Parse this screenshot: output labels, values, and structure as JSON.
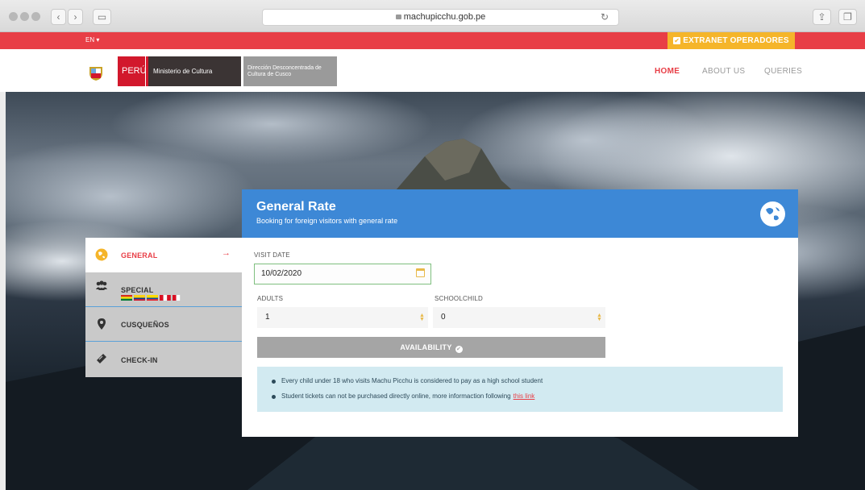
{
  "browser": {
    "url": "machupicchu.gob.pe",
    "icons": [
      "back-icon",
      "forward-icon",
      "sidebar-icon",
      "lock-icon",
      "reload-icon",
      "share-icon",
      "tabs-icon"
    ]
  },
  "topbar": {
    "language": "EN ▾",
    "extranet_label": "EXTRANET OPERADORES"
  },
  "header": {
    "logo_peru": "PERÚ",
    "logo_ministry": "Ministerio de Cultura",
    "logo_ddc": "Dirección Desconcentrada de Cultura de Cusco",
    "nav": [
      {
        "label": "HOME",
        "active": true
      },
      {
        "label": "ABOUT US",
        "active": false
      },
      {
        "label": "QUERIES",
        "active": false
      }
    ]
  },
  "sidebar": {
    "tabs": [
      {
        "label": "GENERAL",
        "icon": "globe-icon",
        "active": true
      },
      {
        "label": "SPECIAL",
        "icon": "group-icon",
        "active": false
      },
      {
        "label": "CUSQUEÑOS",
        "icon": "map-pin-icon",
        "active": false
      },
      {
        "label": "CHECK-IN",
        "icon": "ticket-icon",
        "active": false
      }
    ]
  },
  "panel": {
    "title": "General Rate",
    "subtitle": "Booking for foreign visitors with general rate",
    "visit_date_label": "VISIT DATE",
    "visit_date_value": "10/02/2020",
    "adults_label": "ADULTS",
    "adults_value": "1",
    "schoolchild_label": "SCHOOLCHILD",
    "schoolchild_value": "0",
    "availability_label": "AVAILABILITY",
    "info": [
      "Every child under 18 who visits Machu Picchu is considered to pay as a high school student",
      "Student tickets can not be purchased directly online, more informaction following"
    ],
    "info_link": "this link"
  },
  "colors": {
    "brand_red": "#e83e46",
    "extranet_yellow": "#f5b52a",
    "panel_blue": "#3d88d6",
    "info_bg": "#d2eaf1",
    "button_grey": "#a5a5a5"
  }
}
